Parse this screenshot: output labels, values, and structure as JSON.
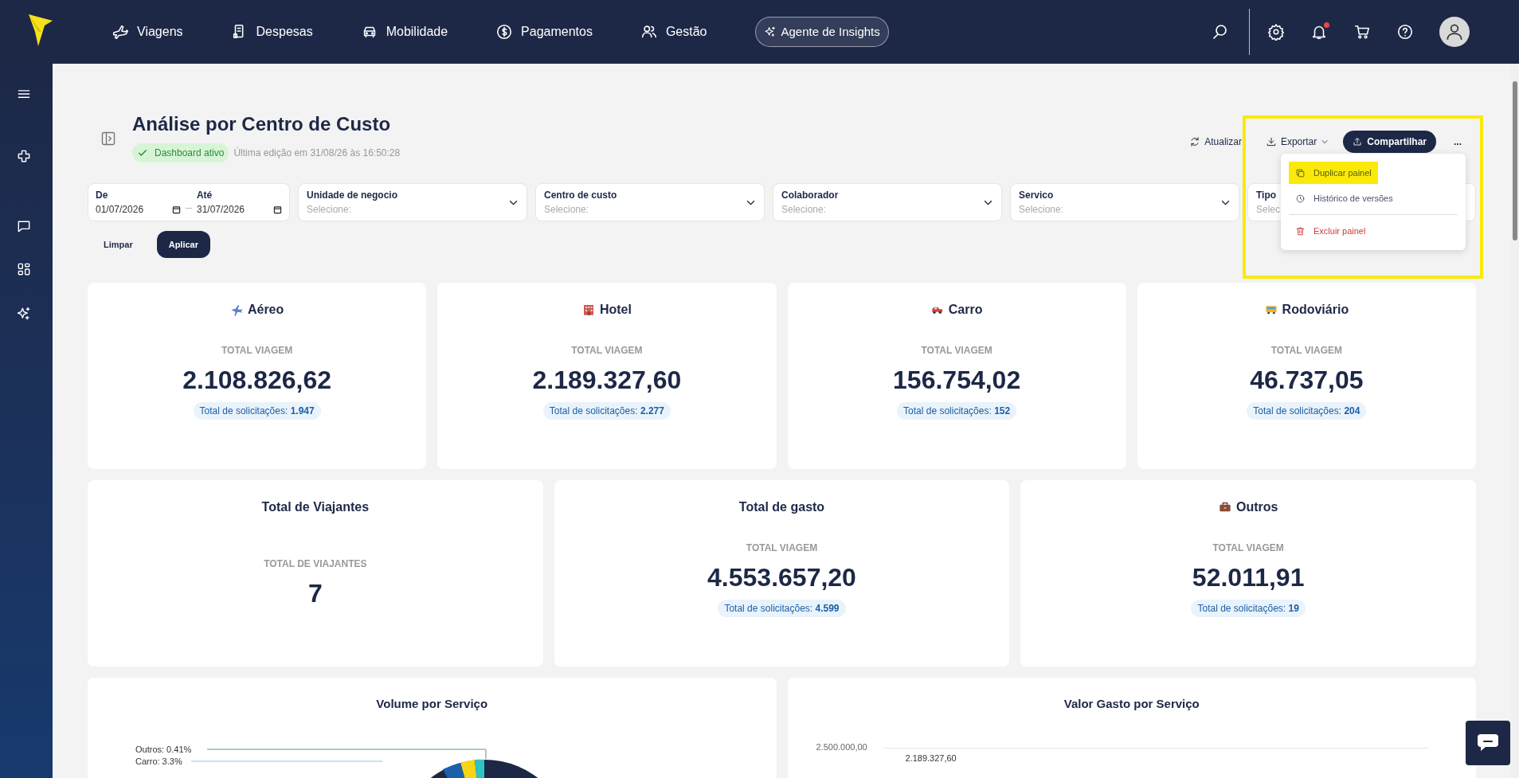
{
  "nav": {
    "items": [
      {
        "kind": "plane",
        "label": "Viagens"
      },
      {
        "kind": "receipt",
        "label": "Despesas"
      },
      {
        "kind": "car",
        "label": "Mobilidade"
      },
      {
        "kind": "dollar",
        "label": "Pagamentos"
      },
      {
        "kind": "people",
        "label": "Gestão"
      }
    ],
    "insights_button": "Agente de Insights",
    "notification_dot": true
  },
  "sidebar": {
    "items": [
      {
        "kind": "menu"
      },
      {
        "kind": "plus"
      },
      {
        "kind": "chat"
      },
      {
        "kind": "grid"
      },
      {
        "kind": "sparkle"
      }
    ]
  },
  "header": {
    "title": "Análise por Centro de Custo",
    "status": "Dashboard ativo",
    "last_edit": "Última edição em 31/08/26 às 16:50:28",
    "actions": [
      {
        "kind": "refresh",
        "label": "Atualizar"
      },
      {
        "kind": "export",
        "label": "Exportar"
      },
      {
        "kind": "share",
        "label": "Compartilhar"
      },
      {
        "kind": "more",
        "label": "..."
      }
    ]
  },
  "menu": {
    "items": [
      {
        "kind": "copy",
        "label": "Duplicar painel",
        "highlighted": true
      },
      {
        "kind": "history",
        "label": "Histórico de versões",
        "highlighted": false
      },
      {
        "kind": "delete",
        "label": "Excluir painel",
        "highlighted": false
      }
    ]
  },
  "filters": {
    "date": {
      "from_label": "De",
      "from_value": "01/07/2026",
      "to_label": "Até",
      "to_value": "31/07/2026"
    },
    "selects": [
      {
        "label": "Unidade de negocio",
        "placeholder": "Selecione:"
      },
      {
        "label": "Centro de custo",
        "placeholder": "Selecione:"
      },
      {
        "label": "Colaborador",
        "placeholder": "Selecione:"
      },
      {
        "label": "Servico",
        "placeholder": "Selecione:"
      },
      {
        "label": "Tipo",
        "placeholder": "Selec"
      }
    ],
    "buttons": [
      "Limpar",
      "Aplicar"
    ]
  },
  "cards_row1": [
    {
      "kind": "plane",
      "title": "Aéreo",
      "caption": "TOTAL VIAGEM",
      "value": "2.108.826,62",
      "count_label": "Total de solicitações:",
      "count": "1.947"
    },
    {
      "kind": "hotel",
      "title": "Hotel",
      "caption": "TOTAL VIAGEM",
      "value": "2.189.327,60",
      "count_label": "Total de solicitações:",
      "count": "2.277"
    },
    {
      "kind": "car",
      "title": "Carro",
      "caption": "TOTAL VIAGEM",
      "value": "156.754,02",
      "count_label": "Total de solicitações:",
      "count": "152"
    },
    {
      "kind": "bus",
      "title": "Rodoviário",
      "caption": "TOTAL VIAGEM",
      "value": "46.737,05",
      "count_label": "Total de solicitações:",
      "count": "204"
    }
  ],
  "cards_row2": [
    {
      "kind": "plain",
      "title": "Total de Viajantes",
      "caption": "TOTAL DE VIAJANTES",
      "value": "7"
    },
    {
      "kind": "plain",
      "title": "Total de gasto",
      "caption": "TOTAL VIAGEM",
      "value": "4.553.657,20",
      "count_label": "Total de solicitações:",
      "count": "4.599"
    },
    {
      "kind": "briefcase",
      "title": "Outros",
      "caption": "TOTAL VIAGEM",
      "value": "52.011,91",
      "count_label": "Total de solicitações:",
      "count": "19"
    }
  ],
  "charts": [
    {
      "title": "Volume por Serviço",
      "labels": [
        "Outros: 0.41%",
        "Carro: 3.3%"
      ]
    },
    {
      "title": "Valor Gasto por Serviço",
      "labels": [
        "2.500.000,00",
        "2.189.327,60"
      ]
    }
  ]
}
